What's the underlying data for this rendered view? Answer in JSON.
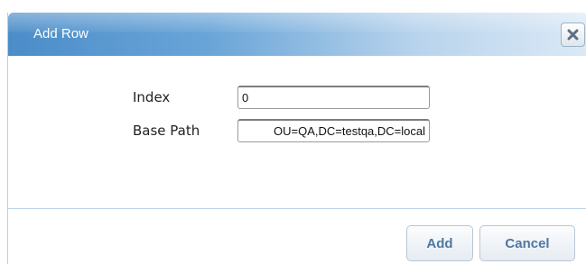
{
  "dialog": {
    "title": "Add Row",
    "close_icon": "close-x-icon"
  },
  "form": {
    "index_label": "Index",
    "index_value": "0",
    "base_path_label": "Base Path",
    "base_path_value": "OU=QA,DC=testqa,DC=local"
  },
  "buttons": {
    "add_label": "Add",
    "cancel_label": "Cancel"
  },
  "colors": {
    "titlebar_start": "#4b8dc9",
    "titlebar_end": "#dbe9f6",
    "button_text": "#4e77a2"
  }
}
